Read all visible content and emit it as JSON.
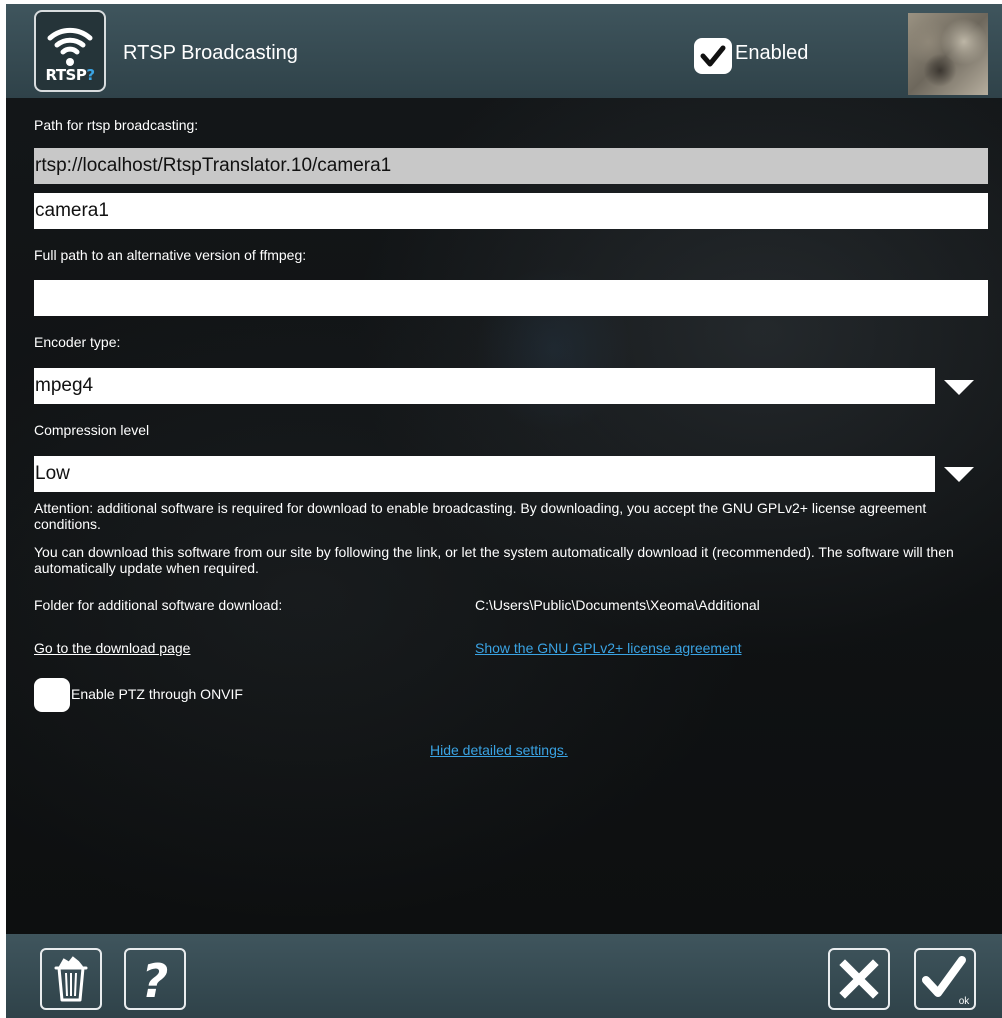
{
  "header": {
    "logo_text": "RTSP",
    "logo_accent": "?",
    "title": "RTSP Broadcasting",
    "enabled_label": "Enabled",
    "enabled_checked": true
  },
  "form": {
    "path_label": "Path for rtsp broadcasting:",
    "rtsp_url": "rtsp://localhost/RtspTranslator.10/camera1",
    "stream_name": "camera1",
    "ffmpeg_label": "Full path to an alternative version of ffmpeg:",
    "ffmpeg_path": "",
    "encoder_label": "Encoder type:",
    "encoder_value": "mpeg4",
    "compression_label": "Compression level",
    "compression_value": "Low"
  },
  "notes": {
    "attention": "Attention: additional software is required for download to enable broadcasting. By downloading, you accept the GNU GPLv2+ license agreement conditions.",
    "download_info": "You can download this software from our site by following the link, or let the system automatically download it (recommended). The software will then automatically update when required.",
    "folder_label": "Folder for additional software download:",
    "folder_path": "C:\\Users\\Public\\Documents\\Xeoma\\Additional",
    "download_link": "Go to the download page",
    "license_link": "Show the GNU GPLv2+ license agreement",
    "ptz_label": "Enable PTZ through ONVIF",
    "ptz_checked": false,
    "hide_settings_link": "Hide detailed settings."
  },
  "footer": {
    "ok_sub": "ok"
  },
  "colors": {
    "header_bg": "#3f555d",
    "link_blue": "#3aa3e3",
    "panel_bg": "#0f1112"
  },
  "icons": [
    "wifi-icon",
    "checkmark-icon",
    "trash-icon",
    "help-icon",
    "close-icon",
    "ok-icon",
    "chevron-down-icon"
  ]
}
